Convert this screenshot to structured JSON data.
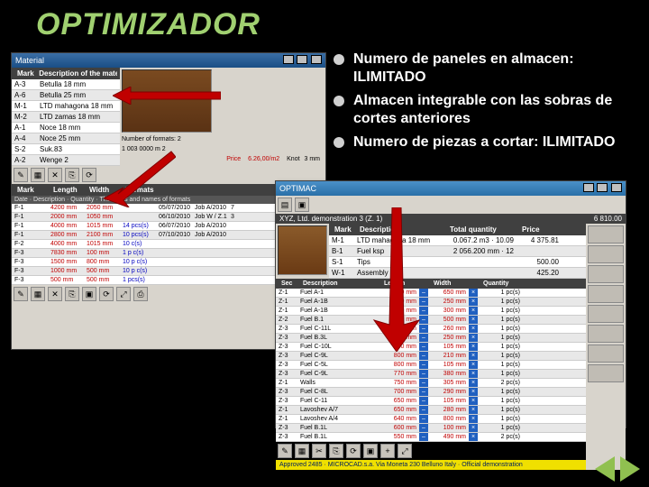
{
  "title": "OPTIMIZADOR",
  "bullets": [
    "Numero de paneles en almacen: ILIMITADO",
    "Almacen integrable con las sobras de cortes anteriores",
    "Numero de piezas a cortar: ILIMITADO"
  ],
  "winA": {
    "title": "Material",
    "cols": {
      "mark": "Mark",
      "desc": "Description of the material"
    },
    "materials": [
      {
        "mark": "A-3",
        "desc": "Betulla 18 mm"
      },
      {
        "mark": "A-6",
        "desc": "Betulla 25 mm"
      },
      {
        "mark": "M-1",
        "desc": "LTD mahagona 18 mm"
      },
      {
        "mark": "M-2",
        "desc": "LTD zamas 18 mm"
      },
      {
        "mark": "A-1",
        "desc": "Noce 18 mm"
      },
      {
        "mark": "A-4",
        "desc": "Noce 25 mm"
      },
      {
        "mark": "S-2",
        "desc": "Suk.83"
      },
      {
        "mark": "A-2",
        "desc": "Wenge 2"
      }
    ],
    "numfmt_label": "Number of formats:",
    "numfmt_val": "2",
    "grain_label": "1 003 0000 m 2",
    "price_label": "Price",
    "price_val": "6.26,00/m2",
    "knot_label": "Knot",
    "knot_val": "3 mm",
    "fmt_header": "Formats",
    "mid_header": "The cards and names of formats",
    "cols2": {
      "mark": "Mark",
      "len": "Length",
      "wid": "Width",
      "date": "Date",
      "desc": "Description",
      "qty": "Quantity"
    },
    "formats": [
      {
        "mark": "F-1",
        "len": "4200 mm",
        "wid": "2050 mm",
        "date": "05/07/2010",
        "desc": "Job A/2010",
        "qty": "7"
      },
      {
        "mark": "F-1",
        "len": "2000 mm",
        "wid": "1050 mm",
        "date": "06/10/2010",
        "desc": "Job W / Z.1",
        "qty": "3"
      },
      {
        "mark": "F-1",
        "len": "4000 mm",
        "wid": "1015 mm",
        "blue": "14 pcs(s)",
        "date": "06/07/2010",
        "desc": "Job A/2010",
        "qty": ""
      },
      {
        "mark": "F-1",
        "len": "2800 mm",
        "wid": "2100 mm",
        "blue": "10 pcs(s)",
        "date": "07/10/2010",
        "desc": "Job A/2010",
        "qty": ""
      },
      {
        "mark": "F-2",
        "len": "4000 mm",
        "wid": "1015 mm",
        "blue": "10 c(s)",
        "date": "",
        "desc": "",
        "qty": ""
      },
      {
        "mark": "F-3",
        "len": "7830 mm",
        "wid": "100 mm",
        "blue": "1 p c(s)",
        "date": "",
        "desc": "",
        "qty": ""
      },
      {
        "mark": "F-3",
        "len": "1500 mm",
        "wid": "800 mm",
        "blue": "10 p c(s)",
        "date": "",
        "desc": "",
        "qty": ""
      },
      {
        "mark": "F-3",
        "len": "1000 mm",
        "wid": "500 mm",
        "blue": "10 p c(s)",
        "date": "",
        "desc": "",
        "qty": ""
      },
      {
        "mark": "F-3",
        "len": "500 mm",
        "wid": "500 mm",
        "blue": "1 pcs(s)",
        "date": "",
        "desc": "",
        "qty": ""
      }
    ]
  },
  "winB": {
    "title": "OPTIMAC",
    "subtitle": "XYZ, Ltd.  demonstration 3  (Z. 1)",
    "total": "6 810.00",
    "matcols": {
      "mark": "Mark",
      "desc": "Description",
      "qty": "Total quantity",
      "price": "Price"
    },
    "mats": [
      {
        "mark": "M-1",
        "desc": "LTD mahagona 18 mm",
        "qty": "0.067.2 m3 · 10.09",
        "price": "4 375.81"
      },
      {
        "mark": "B-1",
        "desc": "Fuel ksp",
        "qty": "2 056.200 mm · 12",
        "price": ""
      },
      {
        "mark": "S-1",
        "desc": "Tips",
        "qty": "",
        "price": "500.00"
      },
      {
        "mark": "W-1",
        "desc": "Assembly",
        "qty": "",
        "price": "425.20"
      }
    ],
    "cutcols": {
      "sec": "Sec",
      "desc": "Description",
      "len": "Length",
      "wid": "Width",
      "qty": "Quantity"
    },
    "cuts": [
      {
        "sec": "Z-1",
        "desc": "Fuel A-1",
        "len": "1500 mm",
        "wid": "650 mm",
        "qty": "1 pc(s)"
      },
      {
        "sec": "Z-1",
        "desc": "Fuel A-1B",
        "len": "1100 mm",
        "wid": "250 mm",
        "qty": "1 pc(s)"
      },
      {
        "sec": "Z-1",
        "desc": "Fuel A-1B",
        "len": "1150 mm",
        "wid": "300 mm",
        "qty": "1 pc(s)"
      },
      {
        "sec": "Z-2",
        "desc": "Fuel B.1",
        "len": "1000 mm",
        "wid": "500 mm",
        "qty": "1 pc(s)"
      },
      {
        "sec": "Z-3",
        "desc": "Fuel C-11L",
        "len": "900 mm",
        "wid": "260 mm",
        "qty": "1 pc(s)"
      },
      {
        "sec": "Z-3",
        "desc": "Fuel B.3L",
        "len": "900 mm",
        "wid": "250 mm",
        "qty": "1 pc(s)"
      },
      {
        "sec": "Z-3",
        "desc": "Fuel C-10L",
        "len": "800 mm",
        "wid": "105 mm",
        "qty": "1 pc(s)"
      },
      {
        "sec": "Z-3",
        "desc": "Fuel C-9L",
        "len": "800 mm",
        "wid": "210 mm",
        "qty": "1 pc(s)"
      },
      {
        "sec": "Z-3",
        "desc": "Fuel C-5L",
        "len": "800 mm",
        "wid": "105 mm",
        "qty": "1 pc(s)"
      },
      {
        "sec": "Z-3",
        "desc": "Fuel C-9L",
        "len": "770 mm",
        "wid": "380 mm",
        "qty": "1 pc(s)"
      },
      {
        "sec": "Z-1",
        "desc": "Walls",
        "len": "750 mm",
        "wid": "305 mm",
        "qty": "2 pc(s)"
      },
      {
        "sec": "Z-3",
        "desc": "Fuel C-8L",
        "len": "700 mm",
        "wid": "290 mm",
        "qty": "1 pc(s)"
      },
      {
        "sec": "Z-3",
        "desc": "Fuel C-11",
        "len": "650 mm",
        "wid": "105 mm",
        "qty": "1 pc(s)"
      },
      {
        "sec": "Z-1",
        "desc": "Lavoshev A/7",
        "len": "650 mm",
        "wid": "280 mm",
        "qty": "1 pc(s)"
      },
      {
        "sec": "Z-1",
        "desc": "Lavoshev A/4",
        "len": "640 mm",
        "wid": "800 mm",
        "qty": "1 pc(s)"
      },
      {
        "sec": "Z-3",
        "desc": "Fuel B.1L",
        "len": "600 mm",
        "wid": "100 mm",
        "qty": "1 pc(s)"
      },
      {
        "sec": "Z-3",
        "desc": "Fuel B.1L",
        "len": "550 mm",
        "wid": "490 mm",
        "qty": "2 pc(s)"
      }
    ],
    "status": "Approved 2485 · MICROCAD.s.a.  Via Moneta 230 Belluno Italy · Official demonstration"
  }
}
